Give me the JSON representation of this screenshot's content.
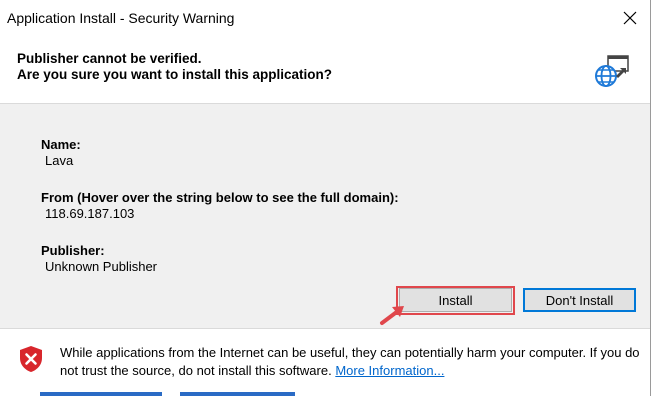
{
  "window": {
    "title": "Application Install - Security Warning"
  },
  "header": {
    "line1": "Publisher cannot be verified.",
    "line2": "Are you sure you want to install this application?"
  },
  "fields": {
    "name_label": "Name:",
    "name_value": "Lava",
    "from_label": "From (Hover over the string below to see the full domain):",
    "from_value": "118.69.187.103",
    "publisher_label": "Publisher:",
    "publisher_value": "Unknown Publisher"
  },
  "buttons": {
    "install": "Install",
    "dont_install": "Don't Install"
  },
  "footer": {
    "warning_text": "While applications from the Internet can be useful, they can potentially harm your computer. If you do not trust the source, do not install this software.",
    "more_info": "More Information..."
  },
  "colors": {
    "highlight": "#e0474c",
    "link": "#0066cc",
    "focus_border": "#0078d7",
    "shield": "#d8262c"
  },
  "icons": {
    "close": "close-icon",
    "app": "globe-window-icon",
    "shield": "shield-x-icon",
    "pointer": "red-arrow-icon"
  }
}
